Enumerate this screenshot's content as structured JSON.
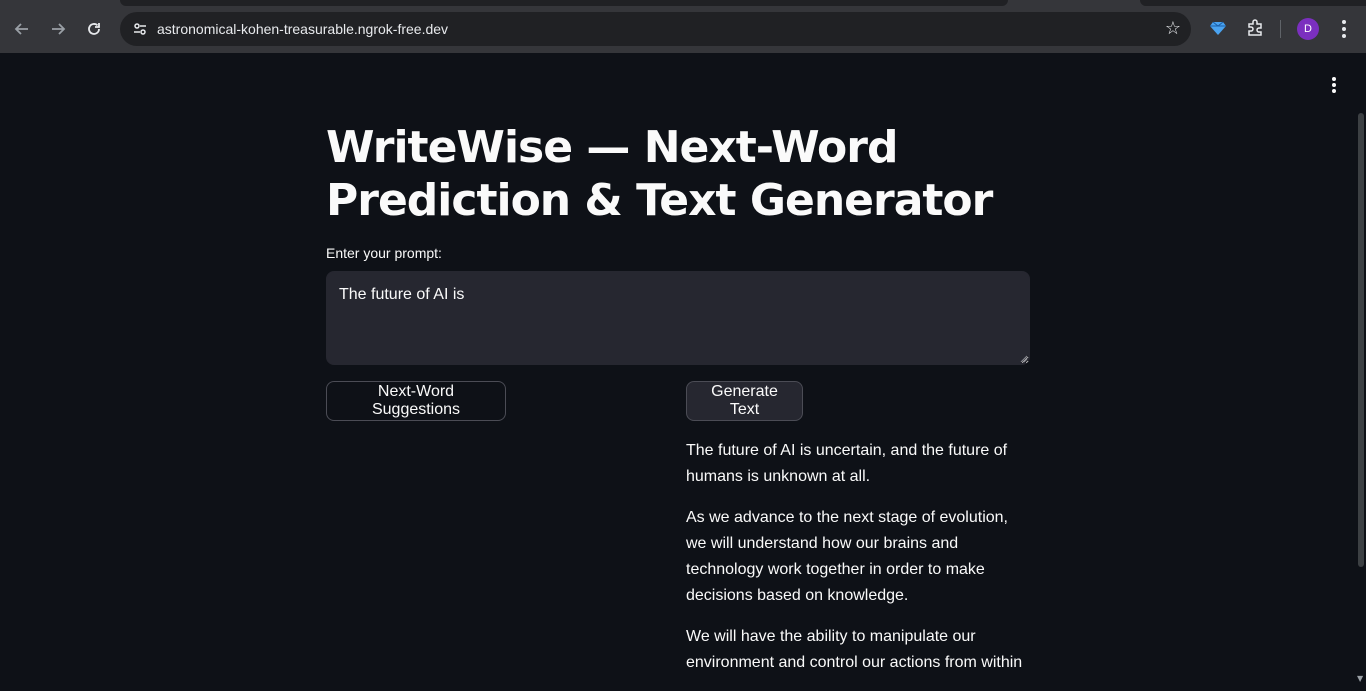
{
  "browser": {
    "url": "astronomical-kohen-treasurable.ngrok-free.dev",
    "profile_initial": "D",
    "icons": [
      "back-icon",
      "forward-icon",
      "reload-icon",
      "site-info-icon",
      "bookmark-star-icon",
      "extension-gem-icon",
      "extensions-puzzle-icon",
      "chrome-menu-icon"
    ]
  },
  "app": {
    "title": "WriteWise — Next-Word Prediction & Text Generator",
    "prompt_label": "Enter your prompt:",
    "prompt_value": "The future of AI is",
    "next_word_button": "Next-Word Suggestions",
    "generate_button": "Generate Text",
    "output_paragraphs": [
      "The future of AI is uncertain, and the future of humans is unknown at all.",
      "As we advance to the next stage of evolution, we will understand how our brains and technology work together in order to make decisions based on knowledge.",
      "We will have the ability to manipulate our environment and control our actions from within"
    ]
  },
  "colors": {
    "page_bg": "#0e1117",
    "input_bg": "#262730",
    "text": "#fafafa",
    "chrome_bg": "#35363a",
    "avatar": "#7b2fbf"
  }
}
